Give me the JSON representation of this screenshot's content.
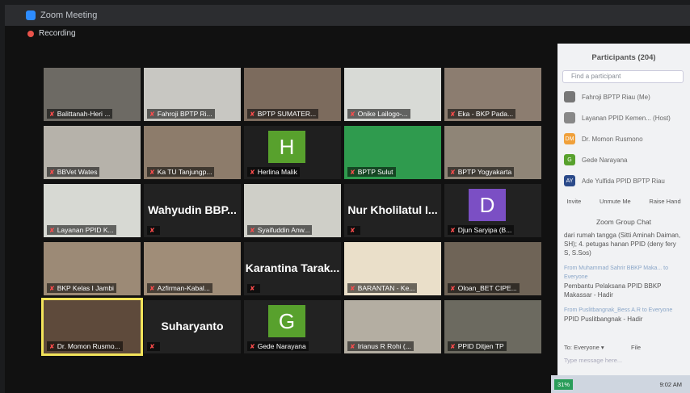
{
  "window": {
    "title": "Zoom Meeting",
    "recording_label": "Recording"
  },
  "tiles": [
    "Balittanah-Heri ...",
    "Fahroji BPTP Ri...",
    "BPTP SUMATER...",
    "Onike Lailogo-...",
    "Eka - BKP Pada...",
    "BBVet Wates",
    "Ka TU Tanjungp...",
    "Herlina Malik",
    "BPTP Sulut",
    "BPTP Yogyakarta",
    "Layanan PPID K...",
    "",
    "Syaifuddin Anw...",
    "",
    "Djun Saryipa (B...",
    "BKP Kelas I Jambi",
    "Azfirman-Kabal...",
    "",
    "BARANTAN - Ke...",
    "Oloan_BET CIPE...",
    "Dr. Momon Rusmo...",
    "",
    "Gede Narayana",
    "Irianus R Rohi (...",
    "PPID Ditjen TP"
  ],
  "big_names": {
    "t11": "Wahyudin BBP...",
    "t13": "Nur Kholilatul I...",
    "t17": "Karantina Tarak...",
    "t21": "Suharyanto"
  },
  "avatars": {
    "t7": "H",
    "t14": "D",
    "t22": "G"
  },
  "colors": {
    "green": "#58a12d",
    "purple": "#7b4fc4",
    "active": "#f2e35a"
  },
  "participants": {
    "title": "Participants (204)",
    "search_placeholder": "Find a participant",
    "list": [
      {
        "name": "Fahroji BPTP Riau (Me)",
        "initials": ""
      },
      {
        "name": "Layanan PPID Kemen... (Host)",
        "initials": ""
      },
      {
        "name": "Dr. Momon Rusmono",
        "initials": "DM"
      },
      {
        "name": "Gede Narayana",
        "initials": "G"
      },
      {
        "name": "Ade Yulfida PPID BPTP Riau",
        "initials": "AY"
      }
    ],
    "buttons": [
      "Invite",
      "Unmute Me",
      "Raise Hand"
    ]
  },
  "chat": {
    "title": "Zoom Group Chat",
    "messages": [
      {
        "from": "",
        "text": "dari rumah tangga (Sitti Aminah Daiman, SH); 4. petugas hanan PPID (deny fery S, S.Sos)"
      },
      {
        "from": "From Muhammad Sahrir BBKP Maka... to Everyone",
        "text": "Pembantu Pelaksana PPID BBKP Makassar - Hadir"
      },
      {
        "from": "From Puslitbangnak_Bess A.R to Everyone",
        "text": "PPID Puslitbangnak - Hadir"
      }
    ],
    "to_label": "To: Everyone ▾",
    "file_label": "File",
    "type_placeholder": "Type message here..."
  },
  "taskbar": {
    "battery": "31%",
    "time": "9:02 AM"
  }
}
